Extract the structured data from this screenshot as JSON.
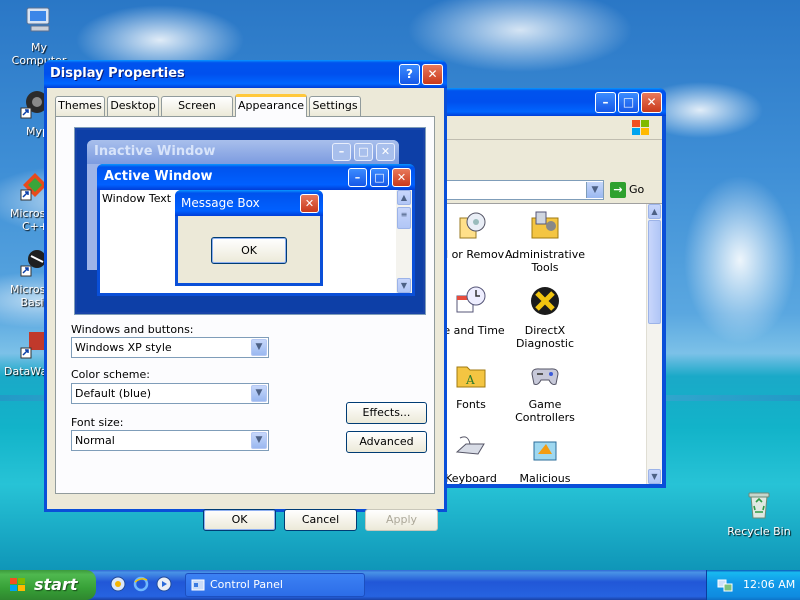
{
  "desktop": {
    "icons": [
      {
        "label": "My Computer"
      },
      {
        "label": "Myp"
      },
      {
        "label": "Microsoft C++"
      },
      {
        "label": "Microsoft Basic"
      },
      {
        "label": "DataWa"
      },
      {
        "label": "Recycle Bin"
      }
    ]
  },
  "control_panel": {
    "title": "Control Panel",
    "go_label": "Go",
    "items": [
      {
        "label": "Add or Remov…",
        "icon": "add-remove-programs-icon"
      },
      {
        "label": "Administrative Tools",
        "icon": "administrative-tools-icon"
      },
      {
        "label": "ce and Time",
        "icon": "date-time-icon"
      },
      {
        "label": "DirectX Diagnostic",
        "icon": "directx-icon"
      },
      {
        "label": "Fonts",
        "icon": "fonts-folder-icon"
      },
      {
        "label": "Game Controllers",
        "icon": "game-controller-icon"
      },
      {
        "label": "Keyboard",
        "icon": "keyboard-icon"
      },
      {
        "label": "Malicious Removal Tool",
        "icon": "malicious-removal-tool-icon"
      }
    ]
  },
  "dialog": {
    "title": "Display Properties",
    "tabs": [
      "Themes",
      "Desktop",
      "Screen Saver",
      "Appearance",
      "Settings"
    ],
    "active_tab": "Appearance",
    "preview": {
      "inactive_title": "Inactive Window",
      "active_title": "Active Window",
      "window_text": "Window Text",
      "message_title": "Message Box",
      "ok_label": "OK"
    },
    "windows_buttons_label": "Windows and buttons:",
    "windows_buttons_value": "Windows XP style",
    "color_scheme_label": "Color scheme:",
    "color_scheme_value": "Default (blue)",
    "font_size_label": "Font size:",
    "font_size_value": "Normal",
    "effects_label": "Effects...",
    "advanced_label": "Advanced",
    "ok_label": "OK",
    "cancel_label": "Cancel",
    "apply_label": "Apply"
  },
  "taskbar": {
    "start_label": "start",
    "task_label": "Control Panel",
    "clock": "12:06 AM"
  }
}
